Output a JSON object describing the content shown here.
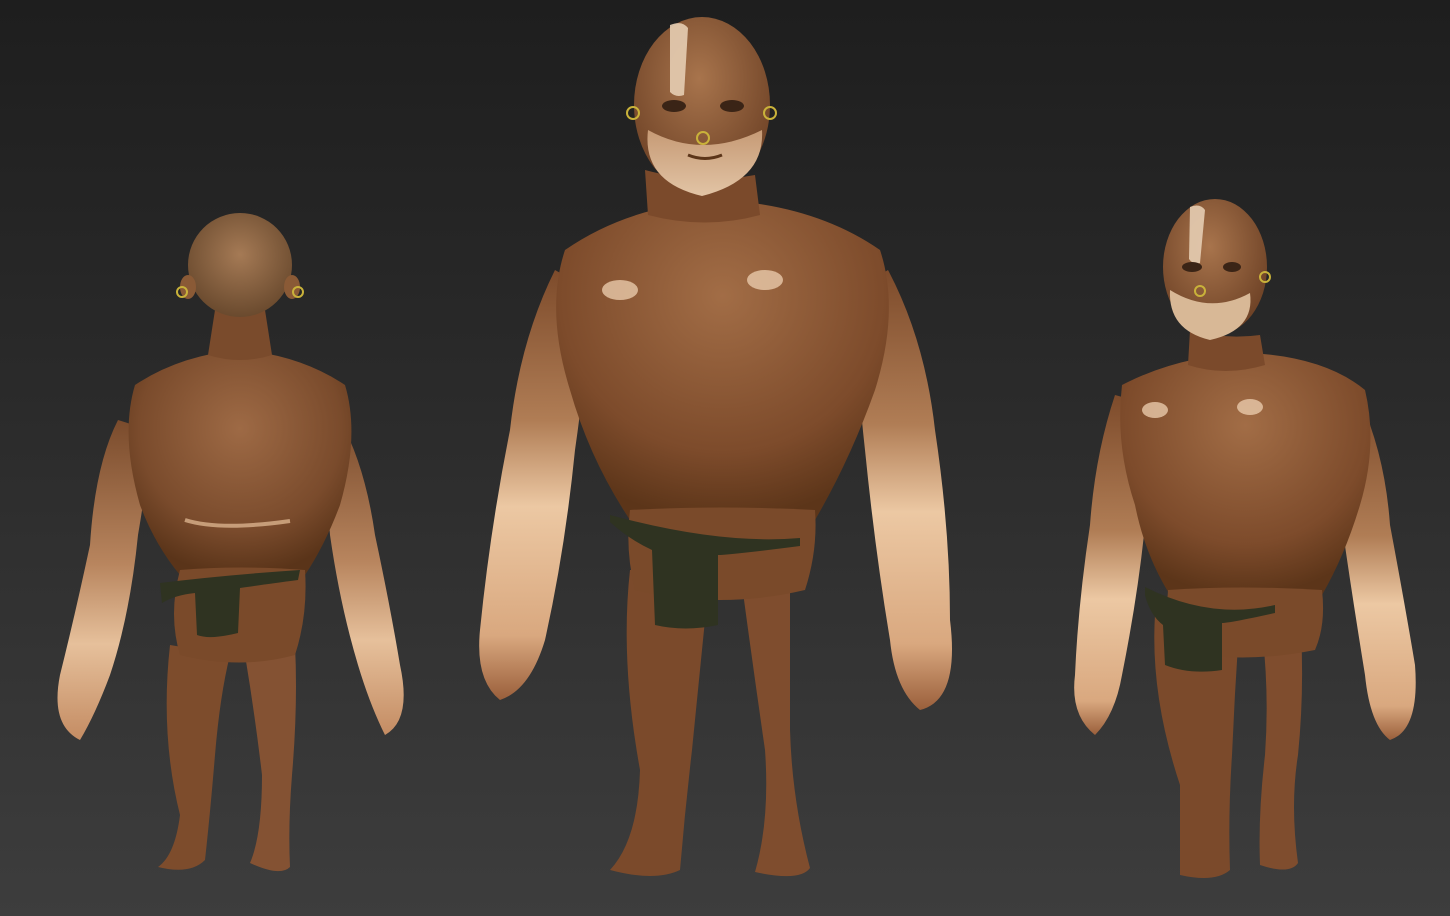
{
  "scene": {
    "background_top": "#1e1e1e",
    "background_bottom": "#3d3d3d",
    "skin_dark": "#7a4b2c",
    "skin_mid": "#9a6440",
    "skin_light": "#e0b58e",
    "loincloth": "#2f3321",
    "earring": "#c9b23a",
    "views": [
      {
        "view": "back"
      },
      {
        "view": "front"
      },
      {
        "view": "three-quarter"
      }
    ]
  }
}
